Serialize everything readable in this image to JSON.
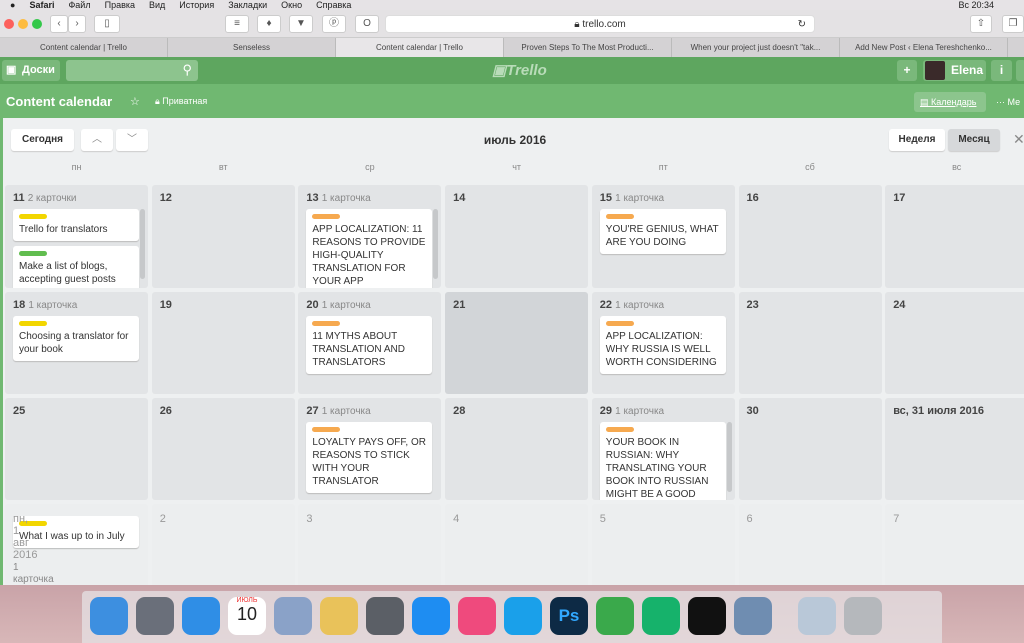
{
  "menubar": {
    "items": [
      "Safari",
      "Файл",
      "Правка",
      "Вид",
      "История",
      "Закладки",
      "Окно",
      "Справка"
    ],
    "clock": "Вс 20:34"
  },
  "browser": {
    "url": "trello.com",
    "tabs": [
      "Content calendar | Trello",
      "Senseless",
      "Content calendar | Trello",
      "Proven Steps To The Most Producti...",
      "When your project just doesn't \"tak...",
      "Add New Post ‹ Elena Tereshchenko..."
    ],
    "active_tab": 2
  },
  "header": {
    "boards": "Доски",
    "logo": "Trello",
    "user": "Elena",
    "add": "+",
    "info": "i"
  },
  "board": {
    "title": "Content calendar",
    "visibility": "Приватная",
    "calendar_btn": "Календарь",
    "menu": "··· Ме"
  },
  "calendar": {
    "today": "Сегодня",
    "month": "июль 2016",
    "week": "Неделя",
    "monthbtn": "Месяц",
    "close": "✕",
    "days": [
      "пн",
      "вт",
      "ср",
      "чт",
      "пт",
      "сб",
      "вс"
    ],
    "rows": [
      [
        {
          "d": "11",
          "c": "2 карточки",
          "cards": [
            {
              "t": "Trello for translators",
              "l": "#f2d600"
            },
            {
              "t": "Make a list of blogs, accepting guest posts",
              "l": "#61bd4f"
            }
          ],
          "scroll": true
        },
        {
          "d": "12"
        },
        {
          "d": "13",
          "c": "1 карточка",
          "cards": [
            {
              "t": "APP LOCALIZATION: 11 REASONS TO PROVIDE HIGH-QUALITY TRANSLATION FOR YOUR APP",
              "l": "#f6a94f"
            }
          ],
          "scroll": true
        },
        {
          "d": "14"
        },
        {
          "d": "15",
          "c": "1 карточка",
          "cards": [
            {
              "t": "YOU'RE GENIUS, WHAT ARE YOU DOING",
              "l": "#f6a94f"
            }
          ]
        },
        {
          "d": "16"
        },
        {
          "d": "17"
        }
      ],
      [
        {
          "d": "18",
          "c": "1 карточка",
          "cards": [
            {
              "t": "Choosing a translator for your book",
              "l": "#f2d600"
            }
          ]
        },
        {
          "d": "19"
        },
        {
          "d": "20",
          "c": "1 карточка",
          "cards": [
            {
              "t": "11 MYTHS ABOUT TRANSLATION AND TRANSLATORS",
              "l": "#f6a94f"
            }
          ]
        },
        {
          "d": "21",
          "today": true
        },
        {
          "d": "22",
          "c": "1 карточка",
          "cards": [
            {
              "t": "APP LOCALIZATION: WHY RUSSIA IS WELL WORTH CONSIDERING",
              "l": "#f6a94f"
            }
          ]
        },
        {
          "d": "23"
        },
        {
          "d": "24"
        }
      ],
      [
        {
          "d": "25"
        },
        {
          "d": "26"
        },
        {
          "d": "27",
          "c": "1 карточка",
          "cards": [
            {
              "t": "LOYALTY PAYS OFF, OR REASONS TO STICK WITH YOUR TRANSLATOR",
              "l": "#f6a94f"
            }
          ]
        },
        {
          "d": "28"
        },
        {
          "d": "29",
          "c": "1 карточка",
          "cards": [
            {
              "t": "YOUR BOOK IN RUSSIAN: WHY TRANSLATING YOUR BOOK INTO RUSSIAN MIGHT BE A GOOD",
              "l": "#f6a94f"
            }
          ],
          "scroll": true
        },
        {
          "d": "30"
        },
        {
          "d": "вс, 31 июля 2016"
        }
      ],
      [
        {
          "d": "пн, 1 авг 2016",
          "c": "1 карточка",
          "cards": [
            {
              "t": "What I was up to in July",
              "l": "#f2d600"
            }
          ],
          "faded": true
        },
        {
          "d": "2",
          "faded": true
        },
        {
          "d": "3",
          "faded": true
        },
        {
          "d": "4",
          "faded": true
        },
        {
          "d": "5",
          "faded": true
        },
        {
          "d": "6",
          "faded": true
        },
        {
          "d": "7",
          "faded": true
        }
      ]
    ]
  },
  "dock": {
    "icons": [
      "finder",
      "launchpad",
      "safari",
      "calendar",
      "preview-mail",
      "textedit",
      "system-preferences",
      "app-store",
      "itunes",
      "skype",
      "photoshop",
      "evernote",
      "grammarly",
      "infinity",
      "image-capture",
      "photo",
      "trash"
    ],
    "calendar_day": "10",
    "calendar_month": "ИЮЛЬ"
  },
  "colors": {
    "header": "#5ea65f",
    "board": "#70b871",
    "yellow": "#f2d600",
    "green": "#61bd4f",
    "orange": "#f6a94f"
  }
}
